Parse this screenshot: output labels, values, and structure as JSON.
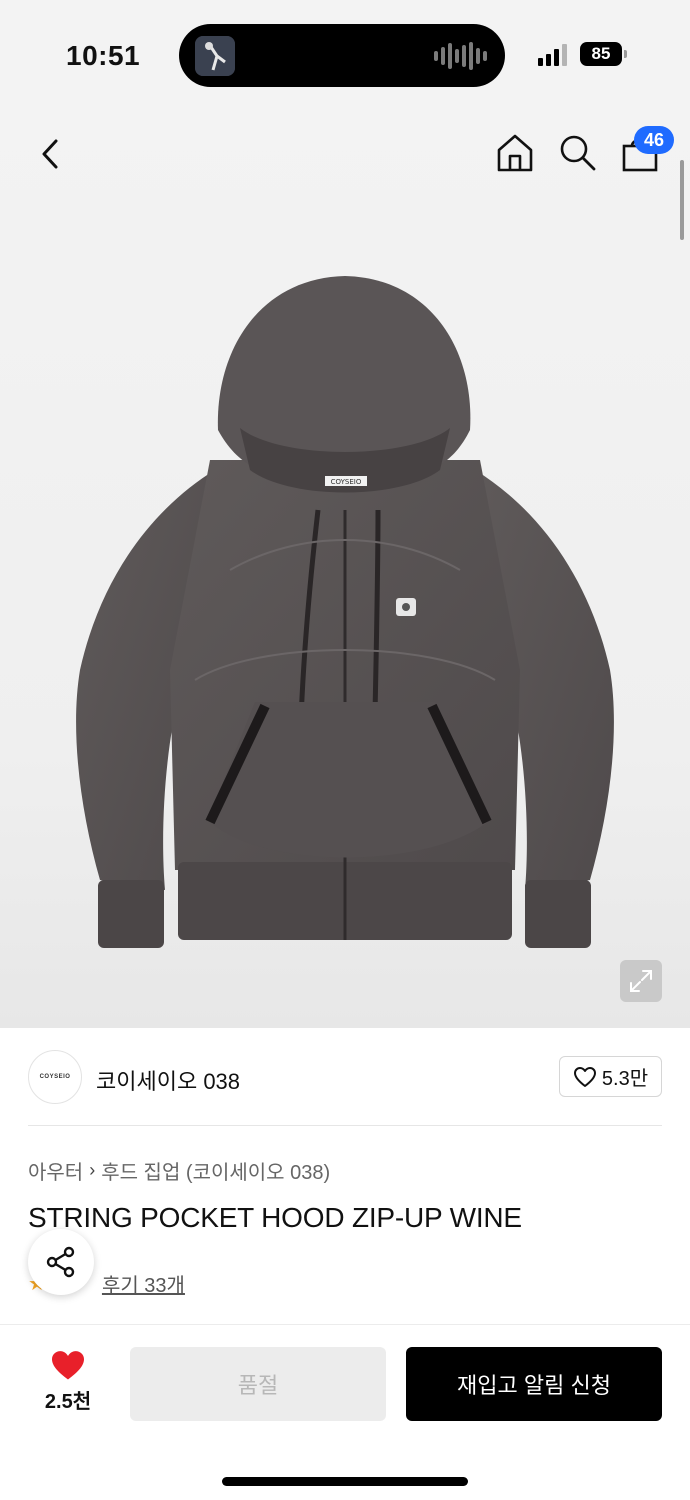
{
  "status_bar": {
    "time": "10:51",
    "battery": "85"
  },
  "header": {
    "cart_count": "46"
  },
  "product_image": {
    "label": "COYSEIO"
  },
  "brand": {
    "logo_text": "COYSEIO",
    "name": "코이세이오 038",
    "likes": "5.3만"
  },
  "breadcrumb": {
    "category": "아우터",
    "subcategory": "후드 집업 (코이세이오 038)"
  },
  "product": {
    "name": "STRING POCKET HOOD ZIP-UP WINE",
    "reviews": "후기 33개"
  },
  "bottom_bar": {
    "wish_count": "2.5천",
    "soldout_label": "품절",
    "restock_label": "재입고 알림 신청"
  },
  "colors": {
    "accent": "#1f6bff",
    "heart": "#e8202a",
    "primary_button": "#000000"
  }
}
